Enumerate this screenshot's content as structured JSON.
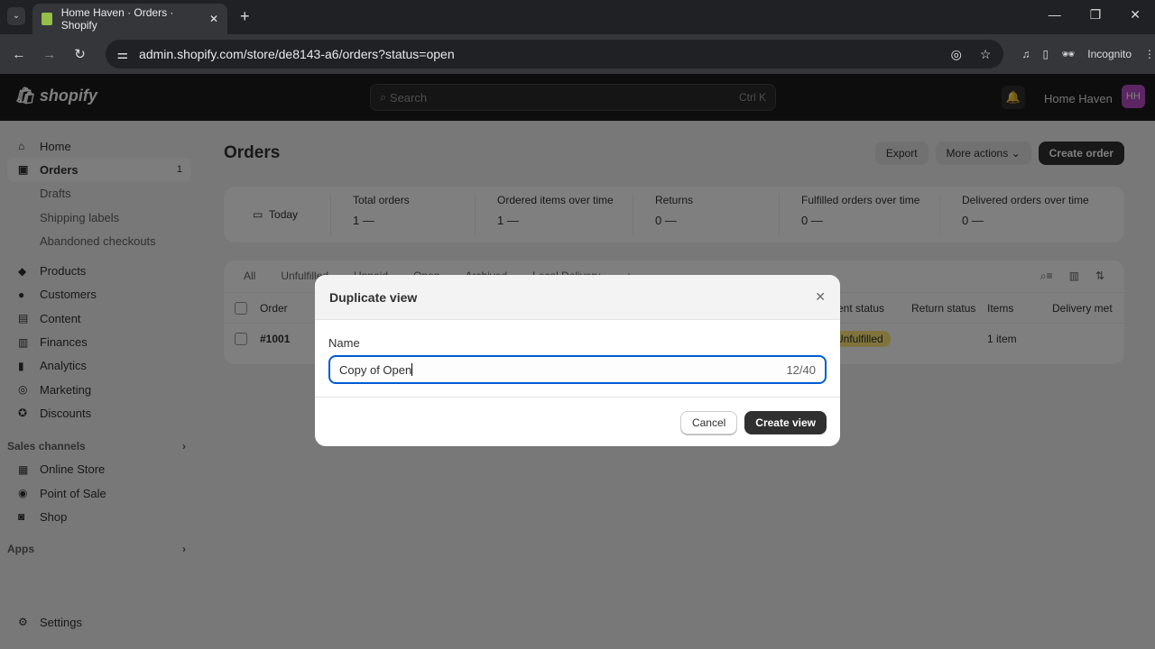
{
  "browser": {
    "tab_title": "Home Haven · Orders · Shopify",
    "url": "admin.shopify.com/store/de8143-a6/orders?status=open",
    "incognito": "Incognito"
  },
  "topbar": {
    "logo": "shopify",
    "search_placeholder": "Search",
    "search_shortcut": "Ctrl K",
    "notifications": "1",
    "store_name": "Home Haven",
    "avatar": "HH"
  },
  "sidebar": {
    "items": [
      {
        "label": "Home",
        "icon": "home-icon"
      },
      {
        "label": "Orders",
        "icon": "orders-icon",
        "count": "1",
        "active": true
      },
      {
        "label": "Drafts",
        "sub": true
      },
      {
        "label": "Shipping labels",
        "sub": true
      },
      {
        "label": "Abandoned checkouts",
        "sub": true
      },
      {
        "label": "Products",
        "icon": "tag-icon"
      },
      {
        "label": "Customers",
        "icon": "person-icon"
      },
      {
        "label": "Content",
        "icon": "content-icon"
      },
      {
        "label": "Finances",
        "icon": "bank-icon"
      },
      {
        "label": "Analytics",
        "icon": "chart-icon"
      },
      {
        "label": "Marketing",
        "icon": "target-icon"
      },
      {
        "label": "Discounts",
        "icon": "discount-icon"
      }
    ],
    "sales_channels": "Sales channels",
    "channels": [
      "Online Store",
      "Point of Sale",
      "Shop"
    ],
    "apps": "Apps",
    "settings": "Settings"
  },
  "main": {
    "title": "Orders",
    "export": "Export",
    "more_actions": "More actions",
    "create_order": "Create order",
    "date": "Today",
    "stats": [
      {
        "label": "Total orders",
        "value": "1"
      },
      {
        "label": "Ordered items over time",
        "value": "1"
      },
      {
        "label": "Returns",
        "value": "0"
      },
      {
        "label": "Fulfilled orders over time",
        "value": "0"
      },
      {
        "label": "Delivered orders over time",
        "value": "0"
      }
    ],
    "tabs": [
      "All",
      "Unfulfilled",
      "Unpaid",
      "Open",
      "Archived",
      "Local Delivery",
      "+"
    ],
    "columns": [
      "Order",
      "ment status",
      "Return status",
      "Items",
      "Delivery met"
    ],
    "row": {
      "order": "#1001",
      "fulfillment": "Unfulfilled",
      "items": "1 item"
    }
  },
  "modal": {
    "title": "Duplicate view",
    "name_label": "Name",
    "name_value": "Copy of Open",
    "counter": "12/40",
    "cancel": "Cancel",
    "create": "Create view"
  }
}
